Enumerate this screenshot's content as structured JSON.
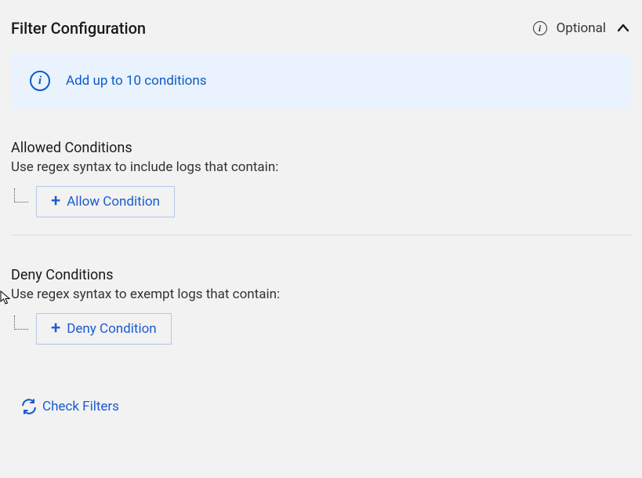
{
  "header": {
    "title": "Filter Configuration",
    "optional_label": "Optional"
  },
  "banner": {
    "text": "Add up to 10 conditions"
  },
  "allowed": {
    "heading": "Allowed Conditions",
    "subtext": "Use regex syntax to include logs that contain:",
    "button_label": "Allow Condition"
  },
  "deny": {
    "heading": "Deny Conditions",
    "subtext": "Use regex syntax to exempt logs that contain:",
    "button_label": "Deny Condition"
  },
  "check_filters_label": "Check Filters"
}
